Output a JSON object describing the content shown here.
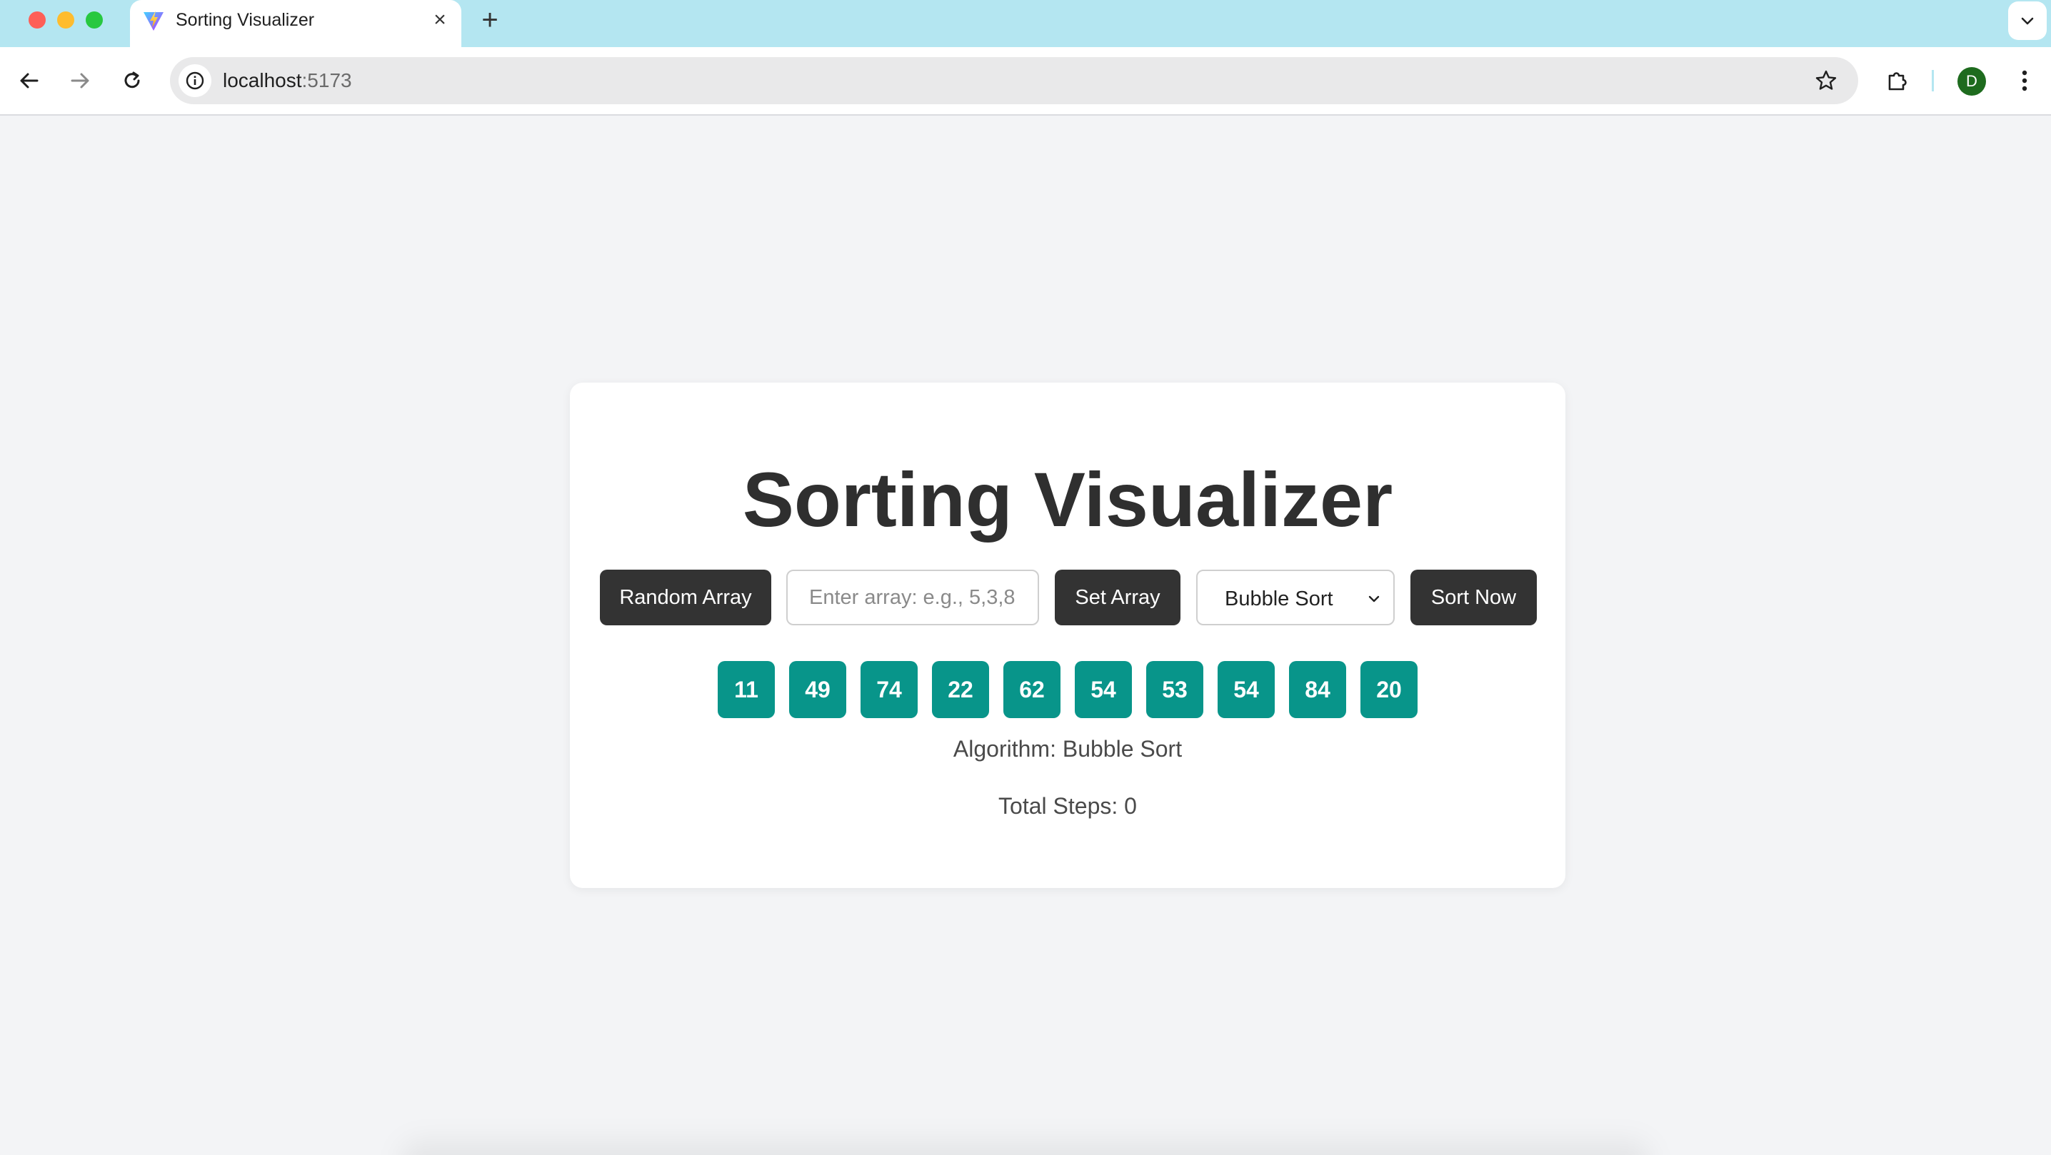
{
  "browser": {
    "tab_title": "Sorting Visualizer",
    "url_host": "localhost",
    "url_port": ":5173",
    "profile_initial": "D",
    "colors": {
      "tabbar": "#b4e6f1",
      "avatar": "#1e6b1e"
    }
  },
  "page": {
    "title": "Sorting Visualizer",
    "controls": {
      "random_label": "Random Array",
      "input_placeholder": "Enter array: e.g., 5,3,8",
      "input_value": "",
      "set_label": "Set Array",
      "algorithm_selected": "Bubble Sort",
      "sort_label": "Sort Now"
    },
    "array": [
      "11",
      "49",
      "74",
      "22",
      "62",
      "54",
      "53",
      "54",
      "84",
      "20"
    ],
    "algorithm_text": "Algorithm: Bubble Sort",
    "steps_text": "Total Steps: 0",
    "colors": {
      "bar": "#08958a",
      "button": "#333333",
      "background": "#f3f4f6"
    }
  }
}
